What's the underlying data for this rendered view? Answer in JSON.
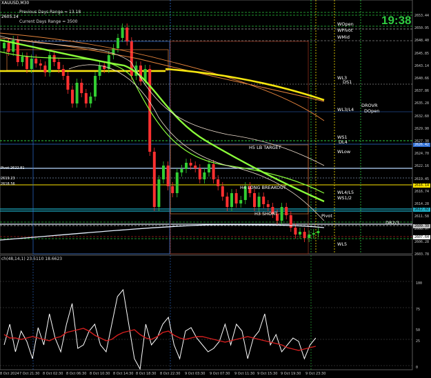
{
  "header": {
    "symbol": "XAUUSD,M30",
    "prev_days_range": "Previous Days Range = 13.18",
    "current_days_range": "Current Days Range = 3500",
    "line3": "2605.14",
    "line4": "26.44 04"
  },
  "clock": "19:38",
  "price_axis": {
    "labels": [
      "2653.44",
      "2650.95",
      "2648.40",
      "2645.85",
      "2643.14",
      "2640.66",
      "2637.86",
      "2635.28",
      "2632.60",
      "2629.90",
      "2627.38",
      "2624.70",
      "2622.16",
      "2619.45",
      "2616.74",
      "2614.28",
      "2611.58",
      "2608.97",
      "2606.28",
      "2603.78"
    ],
    "tags": [
      {
        "text": "2626.42",
        "color": "#2f6fd6",
        "fg": "#fff"
      },
      {
        "text": "2616.14",
        "color": "#ffe600",
        "fg": "#000"
      },
      {
        "text": "2612.02",
        "color": "#1fb0c8",
        "fg": "#000"
      },
      {
        "text": "2609.39",
        "color": "#c0c0c0",
        "fg": "#000"
      },
      {
        "text": "2607.64",
        "color": "#ffffff",
        "fg": "#000"
      }
    ]
  },
  "levels": {
    "wopen": "WOpen",
    "wpivot": "WPivot",
    "wmid": "WMid",
    "wl3": "WL3",
    "ds1": "DS1",
    "wl3l4": "WL3/L4",
    "drovr": "DROVR",
    "dopen": "DOpen",
    "ws1": "WS1",
    "dl4": "DL4",
    "wlow": "WLow",
    "h5_lb_target": "H5 LB TARGET",
    "h4_long_breakout": "H4 LONG BREAKOUT",
    "wl4l5": "WL4/L5",
    "ws12": "WS1/2",
    "h3_short": "H3 SHORT",
    "pivot": "Pivot",
    "dr23": "DR2/3",
    "wl5": "WL5",
    "lb1": "Pivot 2622.81",
    "lb2": "2619.23",
    "lb3": "2618.56"
  },
  "oscillator": {
    "header": "ch(48,14,1) 23.5110 18.6623",
    "levels": [
      "100",
      "75",
      "50",
      "25",
      "0"
    ]
  },
  "time_axis": [
    "8 Oct 2024",
    "7 Oct 21:30",
    "8 Oct 02:30",
    "8 Oct 06:30",
    "8 Oct 10:30",
    "8 Oct 14:30",
    "8 Oct 18:30",
    "8 Oct 22:30",
    "9 Oct 03:30",
    "9 Oct 07:30",
    "9 Oct 11:30",
    "9 Oct 15:30",
    "9 Oct 19:30",
    "9 Oct 23:30"
  ],
  "colors": {
    "bull": "#32cd32",
    "bear": "#ff3030",
    "ma_yellow": "#f5e60f",
    "ma_green": "#8bff3a",
    "ma_orange": "#e6843c",
    "osc_main": "#ffffff",
    "osc_signal": "#d61f1f"
  }
}
